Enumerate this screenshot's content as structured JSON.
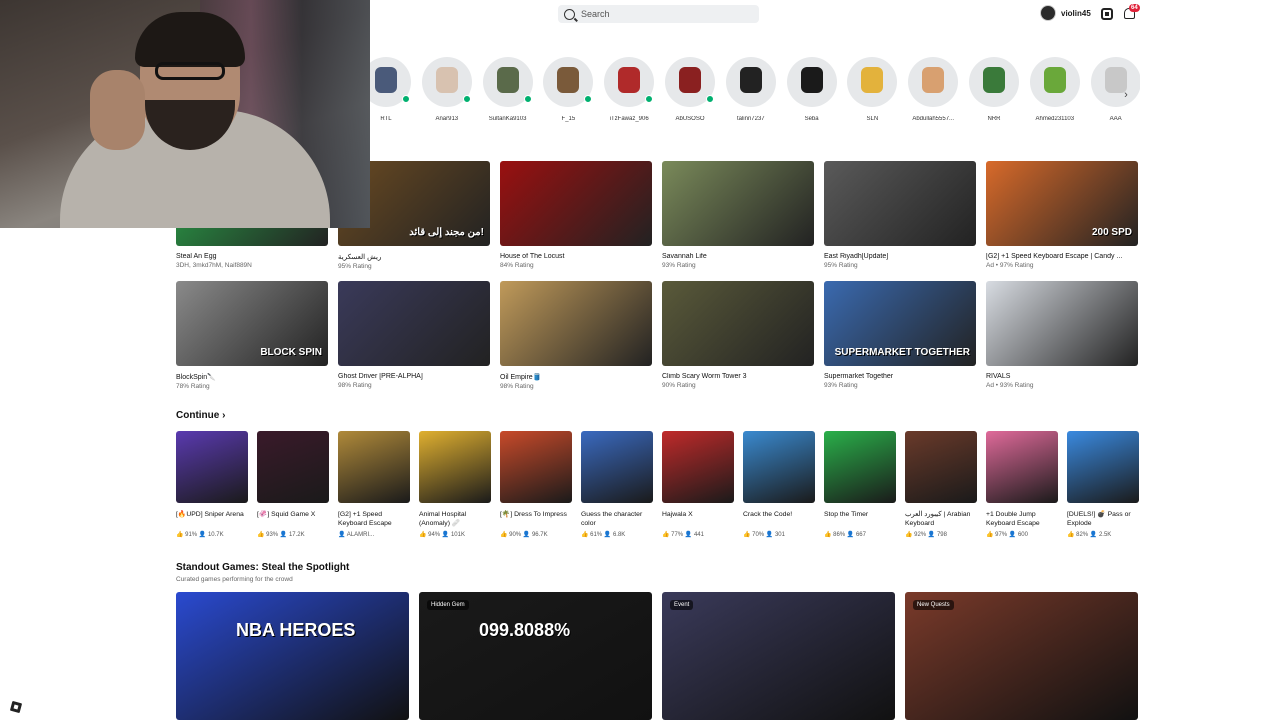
{
  "topbar": {
    "search_placeholder": "Search",
    "username": "violin45",
    "notification_count": "64"
  },
  "friends": [
    {
      "name": "RTL",
      "online": true,
      "color": "#4a5a7a"
    },
    {
      "name": "Anar913",
      "online": true,
      "color": "#d8c2b0"
    },
    {
      "name": "SultanKa9103",
      "online": true,
      "color": "#5a6a4a"
    },
    {
      "name": "F_15",
      "online": true,
      "color": "#7a5a3a"
    },
    {
      "name": "iTzFawaz_906",
      "online": true,
      "color": "#b02a2a"
    },
    {
      "name": "AbUSOSO",
      "online": true,
      "color": "#8a2020"
    },
    {
      "name": "talinn7237",
      "online": false,
      "color": "#222222"
    },
    {
      "name": "Seba",
      "online": false,
      "color": "#1a1a1a"
    },
    {
      "name": "SLN",
      "online": false,
      "color": "#e3b23c"
    },
    {
      "name": "Abdullah5557...",
      "online": false,
      "color": "#d8a070"
    },
    {
      "name": "NRR",
      "online": false,
      "color": "#3a7a3a"
    },
    {
      "name": "Ahmed231103",
      "online": false,
      "color": "#6aa83a"
    },
    {
      "name": "AAA",
      "online": false,
      "color": "#c8c8c8"
    }
  ],
  "recommended_row1": [
    {
      "title": "Steal An Egg",
      "meta": "3DH, 3mkd7hM, Naif889N",
      "color": "#2aa64a"
    },
    {
      "title": "ريش العسكرية",
      "meta": "95% Rating",
      "color": "#6a4a22",
      "overlay": "من مجند إلى قائد!"
    },
    {
      "title": "House of The Locust",
      "meta": "84% Rating",
      "color": "#9a1010"
    },
    {
      "title": "Savannah Life",
      "meta": "93% Rating",
      "color": "#7a8a5a"
    },
    {
      "title": "East Riyadh[Update]",
      "meta": "95% Rating",
      "color": "#5a5a5a"
    },
    {
      "title": "[G2] +1 Speed Keyboard Escape | Candy ...",
      "meta": "Ad • 97% Rating",
      "color": "#d86a2a",
      "overlay": "200 SPD"
    }
  ],
  "recommended_row2": [
    {
      "title": "BlockSpin🔪",
      "meta": "78% Rating",
      "color": "#8a8a8a",
      "overlay": "BLOCK SPIN"
    },
    {
      "title": "Ghost Driver [PRE-ALPHA]",
      "meta": "98% Rating",
      "color": "#3a3a5a"
    },
    {
      "title": "Oil Empire🛢️",
      "meta": "98% Rating",
      "color": "#c09a5a"
    },
    {
      "title": "Climb Scary Worm Tower 3",
      "meta": "90% Rating",
      "color": "#5a5a3a"
    },
    {
      "title": "Supermarket Together",
      "meta": "93% Rating",
      "color": "#3a6ab0",
      "overlay": "SUPERMARKET TOGETHER"
    },
    {
      "title": "RIVALS",
      "meta": "Ad • 93% Rating",
      "color": "#d8dce2"
    }
  ],
  "continue": {
    "label": "Continue",
    "items": [
      {
        "title": "[🔥UPD] Sniper Arena",
        "rating": "91%",
        "players": "10.7K",
        "color": "#5a3ab0"
      },
      {
        "title": "[🦑] Squid Game X",
        "rating": "93%",
        "players": "17.2K",
        "color": "#3a1a2a"
      },
      {
        "title": "[G2] +1 Speed Keyboard Escape",
        "rating": "",
        "players": "ALAMRI...",
        "color": "#b08a3a"
      },
      {
        "title": "Animal Hospital (Anomaly) 🩹",
        "rating": "94%",
        "players": "101K",
        "color": "#e0b030"
      },
      {
        "title": "[🌴] Dress To Impress",
        "rating": "90%",
        "players": "96.7K",
        "color": "#c84a2a"
      },
      {
        "title": "Guess the character color",
        "rating": "61%",
        "players": "6.8K",
        "color": "#3a6ac0"
      },
      {
        "title": "Hajwala X",
        "rating": "77%",
        "players": "441",
        "color": "#c02a2a"
      },
      {
        "title": "Crack the Code!",
        "rating": "70%",
        "players": "301",
        "color": "#3a8ad0"
      },
      {
        "title": "Stop the Timer",
        "rating": "86%",
        "players": "667",
        "color": "#2ab04a"
      },
      {
        "title": "كيبورد العرب | Arabian Keyboard",
        "rating": "92%",
        "players": "798",
        "color": "#6a3a2a"
      },
      {
        "title": "+1 Double Jump Keyboard Escape",
        "rating": "97%",
        "players": "600",
        "color": "#e06a9a"
      },
      {
        "title": "[DUELS!] 💣 Pass or Explode",
        "rating": "82%",
        "players": "2.5K",
        "color": "#3a8ae0"
      }
    ]
  },
  "spotlight": {
    "title": "Standout Games: Steal the Spotlight",
    "subtitle": "Curated games performing for the crowd",
    "items": [
      {
        "tag": "",
        "overlay": "NBA HEROES",
        "color": "#2a4ad0"
      },
      {
        "tag": "Hidden Gem",
        "overlay": "099.8088%",
        "color": "#1a1a1a"
      },
      {
        "tag": "Event",
        "overlay": "",
        "color": "#3a3a5a"
      },
      {
        "tag": "New Quests",
        "overlay": "",
        "color": "#7a3a2a"
      }
    ]
  }
}
